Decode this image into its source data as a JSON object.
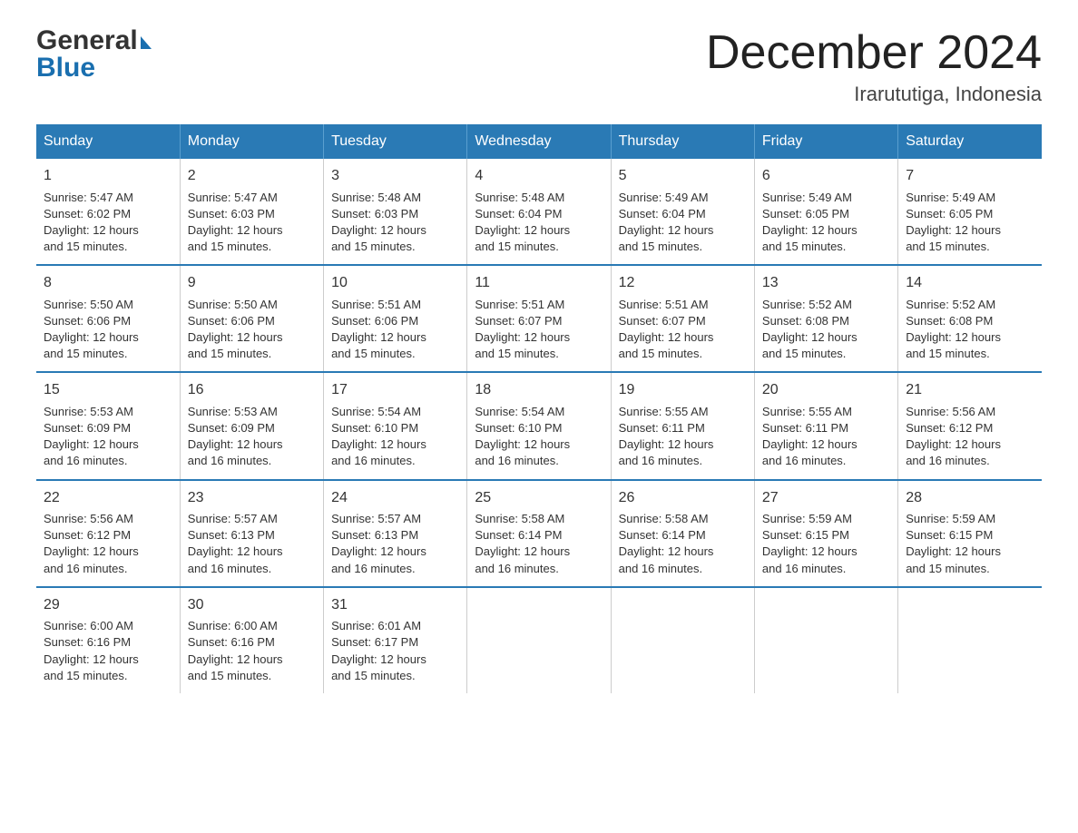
{
  "header": {
    "logo_general": "General",
    "logo_blue": "Blue",
    "month_title": "December 2024",
    "location": "Irarututiga, Indonesia"
  },
  "days_of_week": [
    "Sunday",
    "Monday",
    "Tuesday",
    "Wednesday",
    "Thursday",
    "Friday",
    "Saturday"
  ],
  "weeks": [
    [
      {
        "day": "1",
        "sunrise": "5:47 AM",
        "sunset": "6:02 PM",
        "daylight": "12 hours and 15 minutes."
      },
      {
        "day": "2",
        "sunrise": "5:47 AM",
        "sunset": "6:03 PM",
        "daylight": "12 hours and 15 minutes."
      },
      {
        "day": "3",
        "sunrise": "5:48 AM",
        "sunset": "6:03 PM",
        "daylight": "12 hours and 15 minutes."
      },
      {
        "day": "4",
        "sunrise": "5:48 AM",
        "sunset": "6:04 PM",
        "daylight": "12 hours and 15 minutes."
      },
      {
        "day": "5",
        "sunrise": "5:49 AM",
        "sunset": "6:04 PM",
        "daylight": "12 hours and 15 minutes."
      },
      {
        "day": "6",
        "sunrise": "5:49 AM",
        "sunset": "6:05 PM",
        "daylight": "12 hours and 15 minutes."
      },
      {
        "day": "7",
        "sunrise": "5:49 AM",
        "sunset": "6:05 PM",
        "daylight": "12 hours and 15 minutes."
      }
    ],
    [
      {
        "day": "8",
        "sunrise": "5:50 AM",
        "sunset": "6:06 PM",
        "daylight": "12 hours and 15 minutes."
      },
      {
        "day": "9",
        "sunrise": "5:50 AM",
        "sunset": "6:06 PM",
        "daylight": "12 hours and 15 minutes."
      },
      {
        "day": "10",
        "sunrise": "5:51 AM",
        "sunset": "6:06 PM",
        "daylight": "12 hours and 15 minutes."
      },
      {
        "day": "11",
        "sunrise": "5:51 AM",
        "sunset": "6:07 PM",
        "daylight": "12 hours and 15 minutes."
      },
      {
        "day": "12",
        "sunrise": "5:51 AM",
        "sunset": "6:07 PM",
        "daylight": "12 hours and 15 minutes."
      },
      {
        "day": "13",
        "sunrise": "5:52 AM",
        "sunset": "6:08 PM",
        "daylight": "12 hours and 15 minutes."
      },
      {
        "day": "14",
        "sunrise": "5:52 AM",
        "sunset": "6:08 PM",
        "daylight": "12 hours and 15 minutes."
      }
    ],
    [
      {
        "day": "15",
        "sunrise": "5:53 AM",
        "sunset": "6:09 PM",
        "daylight": "12 hours and 16 minutes."
      },
      {
        "day": "16",
        "sunrise": "5:53 AM",
        "sunset": "6:09 PM",
        "daylight": "12 hours and 16 minutes."
      },
      {
        "day": "17",
        "sunrise": "5:54 AM",
        "sunset": "6:10 PM",
        "daylight": "12 hours and 16 minutes."
      },
      {
        "day": "18",
        "sunrise": "5:54 AM",
        "sunset": "6:10 PM",
        "daylight": "12 hours and 16 minutes."
      },
      {
        "day": "19",
        "sunrise": "5:55 AM",
        "sunset": "6:11 PM",
        "daylight": "12 hours and 16 minutes."
      },
      {
        "day": "20",
        "sunrise": "5:55 AM",
        "sunset": "6:11 PM",
        "daylight": "12 hours and 16 minutes."
      },
      {
        "day": "21",
        "sunrise": "5:56 AM",
        "sunset": "6:12 PM",
        "daylight": "12 hours and 16 minutes."
      }
    ],
    [
      {
        "day": "22",
        "sunrise": "5:56 AM",
        "sunset": "6:12 PM",
        "daylight": "12 hours and 16 minutes."
      },
      {
        "day": "23",
        "sunrise": "5:57 AM",
        "sunset": "6:13 PM",
        "daylight": "12 hours and 16 minutes."
      },
      {
        "day": "24",
        "sunrise": "5:57 AM",
        "sunset": "6:13 PM",
        "daylight": "12 hours and 16 minutes."
      },
      {
        "day": "25",
        "sunrise": "5:58 AM",
        "sunset": "6:14 PM",
        "daylight": "12 hours and 16 minutes."
      },
      {
        "day": "26",
        "sunrise": "5:58 AM",
        "sunset": "6:14 PM",
        "daylight": "12 hours and 16 minutes."
      },
      {
        "day": "27",
        "sunrise": "5:59 AM",
        "sunset": "6:15 PM",
        "daylight": "12 hours and 16 minutes."
      },
      {
        "day": "28",
        "sunrise": "5:59 AM",
        "sunset": "6:15 PM",
        "daylight": "12 hours and 15 minutes."
      }
    ],
    [
      {
        "day": "29",
        "sunrise": "6:00 AM",
        "sunset": "6:16 PM",
        "daylight": "12 hours and 15 minutes."
      },
      {
        "day": "30",
        "sunrise": "6:00 AM",
        "sunset": "6:16 PM",
        "daylight": "12 hours and 15 minutes."
      },
      {
        "day": "31",
        "sunrise": "6:01 AM",
        "sunset": "6:17 PM",
        "daylight": "12 hours and 15 minutes."
      },
      null,
      null,
      null,
      null
    ]
  ]
}
